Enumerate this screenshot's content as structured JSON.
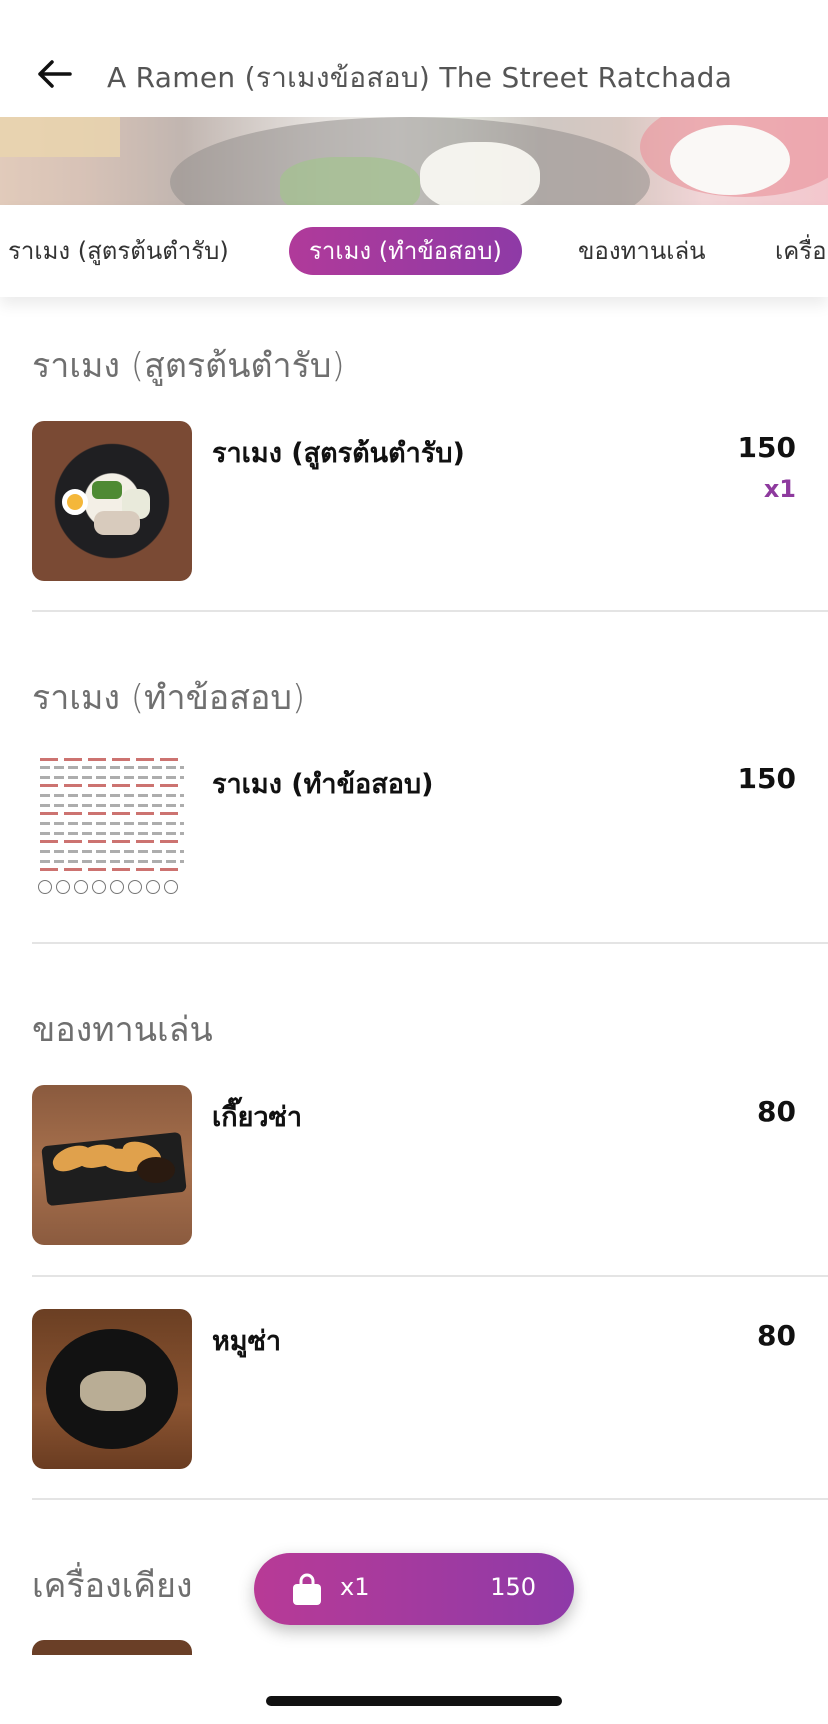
{
  "header": {
    "title": "A Ramen (ราเมงข้อสอบ) The Street Ratchada"
  },
  "tabs": [
    {
      "label": "ราเมง (สูตรต้นตำรับ)",
      "active": false
    },
    {
      "label": "ราเมง (ทำข้อสอบ)",
      "active": true
    },
    {
      "label": "ของทานเล่น",
      "active": false
    },
    {
      "label": "เครื่อ",
      "active": false
    }
  ],
  "sections": [
    {
      "title": "ราเมง (สูตรต้นตำรับ)",
      "items": [
        {
          "name": "ราเมง (สูตรต้นตำรับ)",
          "price": "150",
          "qty": "x1"
        }
      ]
    },
    {
      "title": "ราเมง (ทำข้อสอบ)",
      "items": [
        {
          "name": "ราเมง (ทำข้อสอบ)",
          "price": "150"
        }
      ]
    },
    {
      "title": "ของทานเล่น",
      "items": [
        {
          "name": "เกี๊ยวซ่า",
          "price": "80"
        },
        {
          "name": "หมูซ่า",
          "price": "80"
        }
      ]
    },
    {
      "title": "เครื่องเคียง",
      "items": []
    }
  ],
  "cart": {
    "count": "x1",
    "total": "150",
    "icon": "shopping-bag-icon"
  },
  "colors": {
    "accent_start": "#b83a96",
    "accent_end": "#8e3aa8",
    "qty_text": "#8e3a9e"
  }
}
